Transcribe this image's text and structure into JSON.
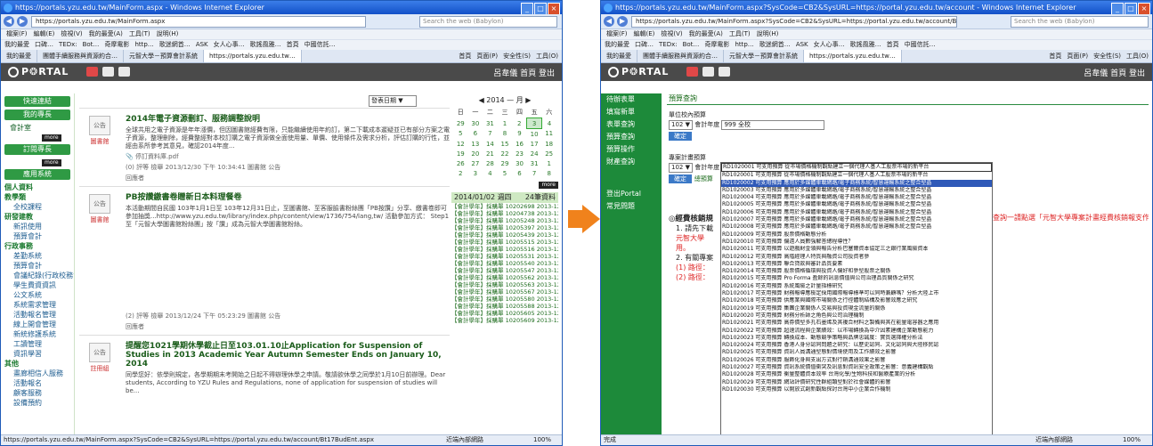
{
  "arrow_color": "#f0821c",
  "left": {
    "window_title": "https://portals.yzu.edu.tw/MainForm.aspx - Windows Internet Explorer",
    "url": "https://portals.yzu.edu.tw/MainForm.aspx",
    "search_placeholder": "Search the web (Babylon)",
    "menu": [
      "檔案(F)",
      "編輯(E)",
      "檢視(V)",
      "我的最愛(A)",
      "工具(T)",
      "說明(H)"
    ],
    "favorites": [
      "我的最愛",
      "口碑…",
      "TEDx:",
      "Bot…",
      "奇摩電影",
      "http…",
      "歌迷網首…",
      "ASK",
      "女人心事…",
      "歌謠風雅…",
      "首頁",
      "中國信託…"
    ],
    "tabs": [
      "我的最愛",
      "團體手續服務與資源約合…",
      "元智大學－預算會計系統",
      "https://portals.yzu.edu.tw…"
    ],
    "cmd": [
      "首頁",
      "頁面(P)",
      "安全性(S)",
      "工具(O)"
    ],
    "user_links": "呂韋儀 首頁 登出",
    "sidebar": {
      "sections": [
        "快速連結",
        "我的專長",
        "訂閱專長",
        "應用系統"
      ],
      "more": "more",
      "items_a": [
        "會計室"
      ],
      "items_b": [
        "個人資料",
        "教學類"
      ],
      "sub_b": [
        "全校課程"
      ],
      "items_c": [
        "研發建教"
      ],
      "sub_c": [
        "新訊使用",
        "預算會計"
      ],
      "items_d": [
        "行政事務"
      ],
      "sub_d": [
        "差勤系統",
        "預算會計",
        "會議紀錄(行政校務會議)",
        "學生費資資訊",
        "公文系統",
        "系統需求管理",
        "活動報名管理",
        "線上開會管理",
        "新統修護系統",
        "工讀管理",
        "資訊學習"
      ],
      "items_e": [
        "其他"
      ],
      "sub_e": [
        "畫廊相信人服務",
        "活動報名",
        "顧客服務",
        "設備預約"
      ]
    },
    "search_dropdown": "發表日期 ▼",
    "posts": [
      {
        "title": "2014年電子資源刪訂、服務調整說明",
        "body": "全球共用之電子資源是年年漲價，但因圖書館經費有限，只能繼續使用年約訂，第二下載成本遲疑並已有部分方案之電子資源，整理刪除，經費整經對本校訂購之電子資源做全面使用量、單價、使用條件及需求分析，評估訂購的行性，並經由系所參考其意見，確認2014年度...",
        "attach": "停訂資料庫.pdf",
        "meta": "(0) 評等 檢舉 2013/12/30 下午 10:34:41 圖書館 公告",
        "reply": "回應者"
      },
      {
        "title": "PB按讚繳書卷贈新日本料理餐卷",
        "body": "本活動期間自民國 103年1月1日至 103年12月31日止，至圖書館、至客服臉書粉絲團「PB按讚」分享、繳書卷即可參加抽獎...http://www.yzu.edu.tw/library/index.php/content/view/1736/754/lang,tw/ 活動參加方式： Step1 至「元智大學圖書館粉絲團」按「讚」成為元智大學圖書館粉絲。",
        "meta": "(2) 評等 檢舉 2013/12/24 下午 05:23:29 圖書館 公告",
        "reply": "回應者"
      },
      {
        "title": "提醒您1021學期休學截止日至103.01.10止Application for Suspension of Studies in 2013 Academic Year Autumn Semester Ends on January 10, 2014",
        "body": "同學您好：依學則規定，各學期期末考開始之日起不得辦理休學之申請。敬請欲休學之同學於1月10日前辦理。Dear students, According to YZU Rules and Regulations, none of application for suspension of studies will be...",
        "meta": ""
      }
    ],
    "calendar": {
      "month": "2014 — 月",
      "weekdays": [
        "日",
        "一",
        "二",
        "三",
        "四",
        "五",
        "六"
      ],
      "weeks": [
        [
          "29",
          "30",
          "31",
          "1",
          "2",
          "3",
          "4"
        ],
        [
          "5",
          "6",
          "7",
          "8",
          "9",
          "10",
          "11"
        ],
        [
          "12",
          "13",
          "14",
          "15",
          "16",
          "17",
          "18"
        ],
        [
          "19",
          "20",
          "21",
          "22",
          "23",
          "24",
          "25"
        ],
        [
          "26",
          "27",
          "28",
          "29",
          "30",
          "31",
          "1"
        ],
        [
          "2",
          "3",
          "4",
          "5",
          "6",
          "7",
          "8"
        ]
      ],
      "today": "3",
      "more": "more"
    },
    "news_head": "2014/01/02 週四",
    "news_count": "24筆資料",
    "news": [
      "【會計學年】採購單 10202698 2013-12-25 00:00 ~ 2014-01-02 23:59",
      "【會計學年】採購單 10204738 2013-12-31 00:00 ~ 2014-01-02 23:59",
      "【會計學年】採購單 10205248 2013-12-18 00:00 ~ 2014-01-02 23:59",
      "【會計學年】採購單 10205397 2013-12-31 00:00 ~ 2014-01-02 23:59",
      "【會計學年】採購單 10205439 2013-12-26 00:00 ~ 2014-01-02 23:59",
      "【會計學年】採購單 10205515 2013-12-25 00:00 ~ 2014-01-02 23:59",
      "【會計學年】採購單 10205516 2013-12-25 00:00 ~ 2014-01-02 23:59",
      "【會計學年】採購單 10205531 2013-12-30 00:00 ~ 2014-01-02 23:59",
      "【會計學年】採購單 10205540 2013-12-27 00:00 ~ 2014-01-02 23:59",
      "【會計學年】採購單 10205547 2013-12-27 00:00 ~ 2014-01-02 23:59",
      "【會計學年】採購單 10205562 2013-12-27 00:00 ~ 2014-01-02 23:59",
      "【會計學年】採購單 10205563 2013-12-27 00:00 ~ 2014-01-02 23:59",
      "【會計學年】採購單 10205567 2013-12-30 00:00 ~ 2014-01-02 23:59",
      "【會計學年】採購單 10205580 2013-12-30 00:00 ~ 2014-01-02 23:59",
      "【會計學年】採購單 10205588 2013-12-30 00:00 ~ 2014-01-02 23:59",
      "【會計學年】採購單 10205605 2013-12-30 00:00 ~ 2014-01-02 23:59",
      "【會計學年】採購單 10205609 2013-12-31 00:00 ~ 2014-01-02 23:59"
    ],
    "status_url": "https://portals.yzu.edu.tw/MainForm.aspx?SysCode=CB2&SysURL=https://portal.yzu.edu.tw/account/Bt17BudEnt.aspx",
    "status_zone": "近端內部網路",
    "zoom": "100%"
  },
  "right": {
    "window_title": "https://portals.yzu.edu.tw/MainForm.aspx?SysCode=CB2&SysURL=https://portal.yzu.edu.tw/account - Windows Internet Explorer",
    "url": "https://portals.yzu.edu.tw/MainForm.aspx?SysCode=CB2&SysURL=https://portal.yzu.edu.tw/account/Bt17BudEnt.aspx",
    "search_placeholder": "Search the web (Babylon)",
    "user_links": "呂韋儀 首頁 登出",
    "sidebar": [
      "待辦表單",
      "填寫新單",
      "表單查詢",
      "預算查詢",
      "預算操作",
      "財產查詢",
      "登出Portal",
      "常見問題"
    ],
    "breadcrumb": "預算查詢",
    "unit_label": "單位校內預算",
    "unit_year": "102 ▼",
    "unit_year_label": "會計年度",
    "unit_dept": "999 全校",
    "query_button": "確定",
    "project_label": "專案計畫預算",
    "project_year": "102 ▼",
    "project_year_label": "會計年度",
    "project_selected": "RD1020001 可支用預算 從市場價格機制觀點建立一個代理人基人工股票市場的新平台",
    "query_button2": "確定",
    "project_note": "總預算",
    "big_heading": "◎經費核銷規",
    "bullets": [
      "1. 請先下載",
      "元智大學",
      "用。",
      "2. 有關專案",
      "(1) 路徑：",
      "(2) 路徑："
    ],
    "overflow_text": "查詢一請點選「元智大學專案計畫經費核銷報支作業手",
    "projects": [
      "RD1020001 可支用預算 從市場價格機制觀點建立一個代理人基人工股票市場的新平台",
      "RD1020001 可支用預算 從市場價格機制觀點建立一個代理人基人工股票市場的新平台",
      "RD1020002 可支用預算 應用於多媒體車載網路/電子商務系統/智慧運輸系統之整合型晶",
      "RD1020003 可支用預算 應用於多媒體車載網路/電子商務系統/智慧運輸系統之整合型晶",
      "RD1020004 可支用預算 應用於多媒體車載網路/電子商務系統/智慧運輸系統之整合型晶",
      "RD1020005 可支用預算 應用於多媒體車載網路/電子商務系統/智慧運輸系統之整合型晶",
      "RD1020006 可支用預算 應用於多媒體車載網路/電子商務系統/智慧運輸系統之整合型晶",
      "RD1020007 可支用預算 應用於多媒體車載網路/電子商務系統/智慧運輸系統之整合型晶",
      "RD1020008 可支用預算 應用於多媒體車載網路/電子商務系統/智慧運輸系統之整合型晶",
      "RD1020009 可支用預算 股票價格動態分析",
      "RD1020010 可支用預算 偏遠人員數強解答總程導性？",
      "RD1020011 可支用預算 以遊戲財金領與報告分析巴塞爾資本協定三之銀行業風險資本",
      "RD1020012 可支用預算 高階經理人特質與融資公司投資者參",
      "RD1020013 可支用預算 聯合貸款與審計品質要素",
      "RD1020014 可支用預算 股票價格循環與投資人偏好和參型股票之關係",
      "RD1020015 可支用預算 Pro Forma 盈餘的訊息價值與公司治理品質關係之研究",
      "RD1020016 可支用預算 系統風險之計量指標研究",
      "RD1020017 可支用預算 財務報導應檢定採用國際報導標準可以同時兼顧嗎？分析大陸上市",
      "RD1020018 可支用預算 供應業與國際市場關係之行徑體制結構及影響效應之研究",
      "RD1020019 可支用預算 集團企業關係人交易與投資現金流量的關係",
      "RD1020020 可支用預算 財務分析師之角色與公司治理機制",
      "RD1020021 可支用預算 高券價型多孔石墨烯及其複合材料之製備與其在能量電容器之應用",
      "RD1020022 可支用預算 超速流程與企業績效：以市場轉換為中介因素建構企業動態能力",
      "RD1020023 可支用預算 轉換成本、動態競爭策略與品牌忠誠度：實質選擇權分析法",
      "RD1020024 可支用預算 香港人身分認同問題之研究：以歷史認同、文化認同與大陸移民認",
      "RD1020025 可支用預算 資訊人員溝通型態對情境使用及工作績效之影響",
      "RD1020026 可支用預算 服飾化身與支出方式對行銷溝通效果之影響",
      "RD1020027 可支用預算 資訊系統價值衝突及訊息對資訊安全政策之影響：意義建構觀點",
      "RD1020028 可支用預算 衡量整體資本效率 台灣化學/生物科技和醫療產業的分析",
      "RD1020029 可支用預算 網站評價研究性群組類型對於社會媒體的影響",
      "RD1020030 可支用預算 以開放式創新觀點探討台灣中小企業合作機制"
    ],
    "selected_index": 2,
    "status_left": "完成",
    "status_zone": "近端內部網路",
    "zoom": "100%"
  }
}
